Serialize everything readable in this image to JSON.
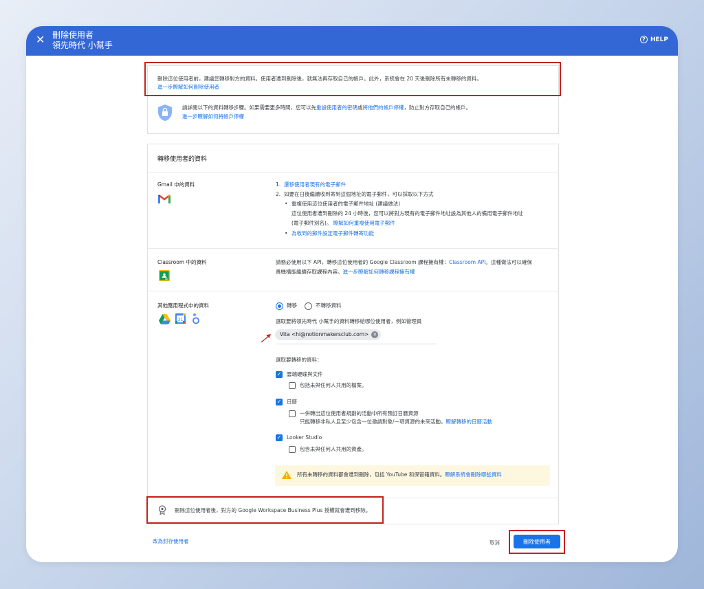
{
  "header": {
    "title": "刪除使用者",
    "subtitle": "領先時代 小幫手",
    "help_label": "HELP"
  },
  "notice": {
    "text": "刪除這位使用者前，建議您轉移對方的資料。使用者遭到刪除後，就無法再存取自己的帳戶。此外，系統會在 20 天後刪除所有未轉移的資料。",
    "link": "進一步瞭解如何刪除使用者"
  },
  "security": {
    "text_before": "請詳閱以下的資料轉移步驟。如果需要更多時間，您可以先",
    "link1": "重設使用者的密碼",
    "or": "或",
    "link2": "將他們的帳戶停權",
    "text_after": "，防止對方存取自己的帳戶。",
    "link3": "進一步瞭解如何將帳戶停權"
  },
  "transfer_title": "轉移使用者的資料",
  "gmail": {
    "label": "Gmail 中的資料",
    "step1_num": "1.",
    "step1_link": "遷移使用者現有的電子郵件",
    "step2_num": "2.",
    "step2_text": "如要在日後繼續收到寄到這個地址的電子郵件，可以採取以下方式",
    "bullet1_title": "重複使用這位使用者的電子郵件地址 (建議做法)",
    "bullet1_desc1": "這位使用者遭到刪除的 24 小時後，您可以將對方現有的電子郵件地址設為其他人的備用電子郵件地址",
    "bullet1_desc2": "(電子郵件別名)。",
    "bullet1_link": "瞭解如何重複使用電子郵件",
    "bullet2_link": "為收到的郵件設定電子郵件轉寄功能"
  },
  "classroom": {
    "label": "Classroom 中的資料",
    "text1_a": "請務必使用以下 API，轉移這位使用者的 Google Classroom 課程擁有權：",
    "api_link": "Classroom API",
    "text1_b": "。這種做法可以確保",
    "text2": "貴機構能繼續存取課程內容。",
    "link": "進一步瞭解如何轉移課程擁有權"
  },
  "other_apps": {
    "label": "其他應用程式中的資料",
    "radio_transfer": "轉移",
    "radio_no_transfer": "不轉移資料",
    "select_user_text": "選取要將領先時代 小幫手的資料轉移給哪位使用者，例如管理員",
    "chip_text": "Vita <hi@notionmakersclub.com>",
    "select_data_text": "選取要轉移的資料：",
    "drive_label": "雲端硬碟與文件",
    "drive_sub": "包括未與任何人共用的檔案。",
    "calendar_label": "日曆",
    "calendar_sub": "一併轉出這位使用者規劃的活動中所有預訂日曆資源",
    "calendar_note": "只能轉移非私人且至少包含一位邀請對象/一項資源的未來活動。",
    "calendar_link": "瞭解轉移的日曆活動",
    "looker_label": "Looker Studio",
    "looker_sub": "包含未與任何人共用的資產。",
    "warn_text": "所有未轉移的資料都會遭到刪除，包括 YouTube 和保管箱資料。",
    "warn_link": "瞭解系統會刪除哪些資料"
  },
  "license_text": "刪除這位使用者後，對方的 Google Workspace Business Plus 授權就會遭到移除。",
  "footer": {
    "archive_link": "改為封存使用者",
    "cancel": "取消",
    "delete": "刪除使用者"
  },
  "colors": {
    "header": "#3367d6",
    "accent": "#1a73e8",
    "highlight_red": "#c5221f",
    "warn_bg": "#fef7e0"
  }
}
